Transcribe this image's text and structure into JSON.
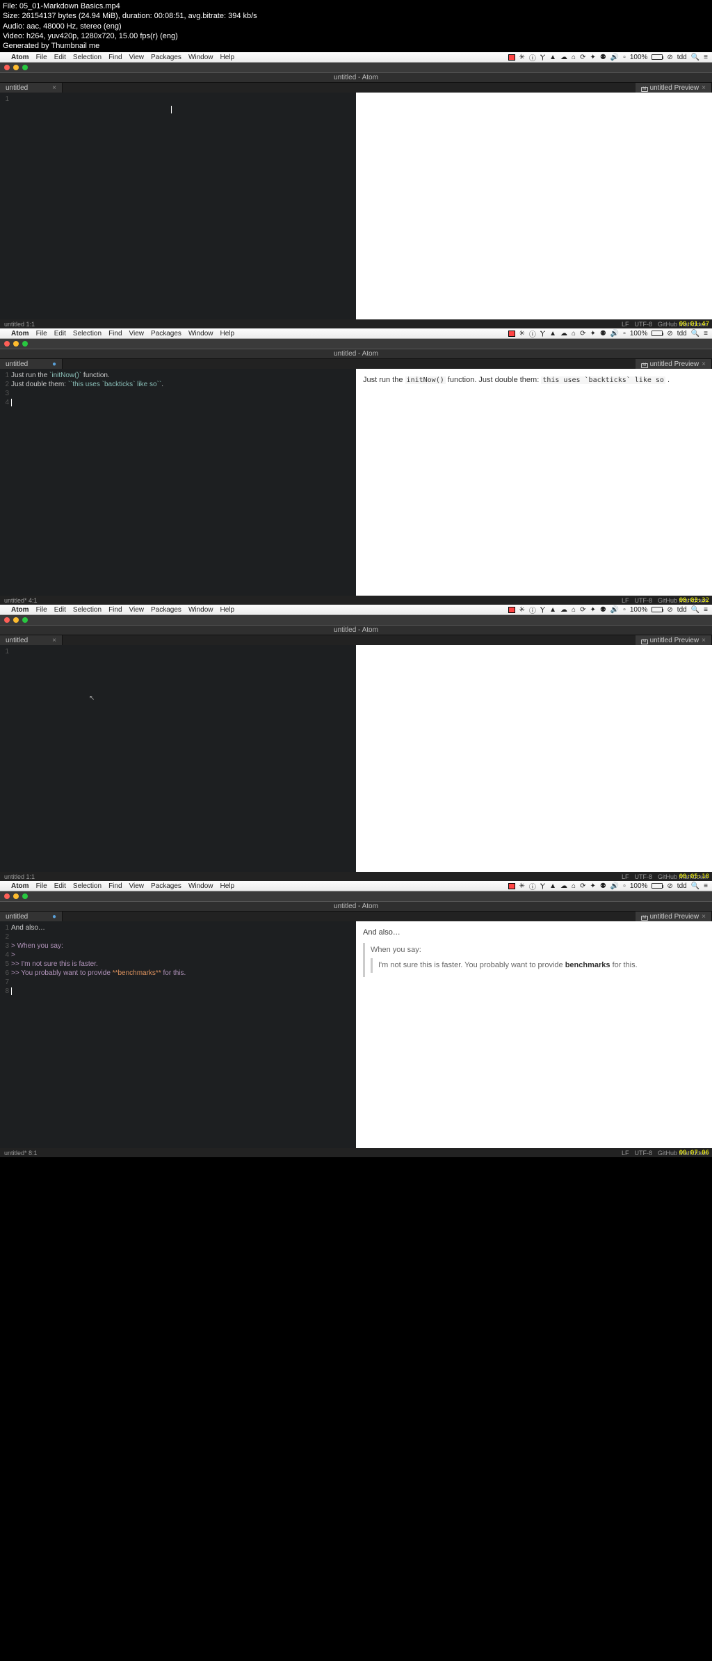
{
  "meta": {
    "file": "File: 05_01-Markdown Basics.mp4",
    "size": "Size: 26154137 bytes (24.94 MiB), duration: 00:08:51, avg.bitrate: 394 kb/s",
    "audio": "Audio: aac, 48000 Hz, stereo (eng)",
    "video": "Video: h264, yuv420p, 1280x720, 15.00 fps(r) (eng)",
    "gen": "Generated by Thumbnail me"
  },
  "menu": {
    "apple": "",
    "items": [
      "Atom",
      "File",
      "Edit",
      "Selection",
      "Find",
      "View",
      "Packages",
      "Window",
      "Help"
    ],
    "batt_pct": "100%",
    "clock": "tdd"
  },
  "title": "untitled - Atom",
  "tabs": {
    "untitled": "untitled",
    "preview": "untitled Preview"
  },
  "status": {
    "s1": {
      "left": "untitled    1:1",
      "right": [
        "LF",
        "UTF-8",
        "GitHub Markdown"
      ]
    },
    "s2": {
      "left": "untitled*   4:1",
      "right": [
        "LF",
        "UTF-8",
        "GitHub Markdown"
      ]
    },
    "s3": {
      "left": "untitled    1:1",
      "right": [
        "LF",
        "UTF-8",
        "GitHub Markdown"
      ]
    },
    "s4": {
      "left": "untitled*   8:1",
      "right": [
        "LF",
        "UTF-8",
        "GitHub Markdown"
      ]
    }
  },
  "timestamps": {
    "t1": "00:01:47",
    "t2": "00:03:32",
    "t3": "00:05:18",
    "t4": "00:07:06"
  },
  "shot2": {
    "lines": [
      "1",
      "2",
      "3",
      "4"
    ],
    "code_l1_a": "Just run the ",
    "code_l1_b": "`initNow()`",
    "code_l1_c": " function.",
    "code_l2_a": "Just double them: ",
    "code_l2_b": "``this uses `backticks` like so``",
    "code_l2_c": ".",
    "prev_a": "Just run the ",
    "prev_b": "initNow()",
    "prev_c": " function. Just double them: ",
    "prev_d": "this uses `backticks` like so",
    "prev_e": " ."
  },
  "shot4": {
    "lines": [
      "1",
      "2",
      "3",
      "4",
      "5",
      "6",
      "7",
      "8"
    ],
    "l1": "And also…",
    "l3": "> When you say:",
    "l4": ">",
    "l5": ">> I'm not sure this is faster.",
    "l6a": ">> You probably want to provide ",
    "l6b": "**benchmarks**",
    "l6c": " for this.",
    "p_head": "And also…",
    "p_q1": "When you say:",
    "p_q2a": "I'm not sure this is faster. You probably want to provide ",
    "p_q2b": "benchmarks",
    "p_q2c": " for this."
  }
}
